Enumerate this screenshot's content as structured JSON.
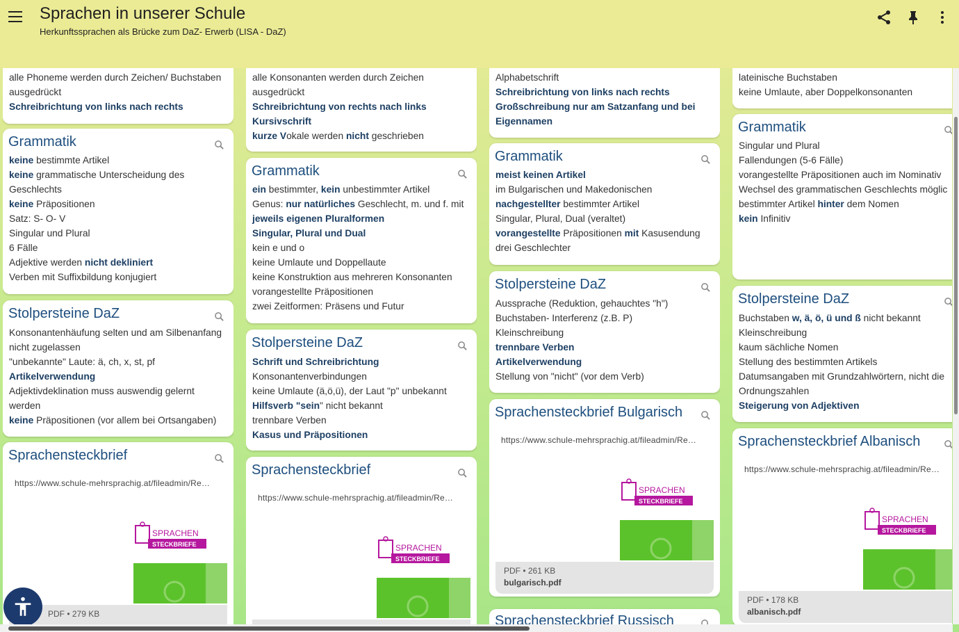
{
  "header": {
    "title": "Sprachen in unserer Schule",
    "subtitle": "Herkunftssprachen als Brücke zum DaZ- Erwerb (LISA - DaZ)",
    "icons": [
      "menu-icon",
      "share-icon",
      "pin-icon",
      "more-vert-icon"
    ]
  },
  "col1": {
    "top": [
      "alle Phoneme werden durch Zeichen/ Buchstaben",
      "ausgedrückt",
      "**Schreibrichtung von links nach rechts**"
    ],
    "gram_title": "Grammatik",
    "gram": [
      "**keine**  bestimmte Artikel",
      "**keine** grammatische Unterscheidung des",
      "Geschlechts",
      "**keine** Präpositionen",
      "Satz: S- O- V",
      "Singular und Plural",
      "6 Fälle",
      "Adjektive werden **nicht dekliniert**",
      "Verben mit Suffixbildung konjugiert"
    ],
    "stol_title": "Stolpersteine DaZ",
    "stol": [
      "Konsonantenhäufung selten und am Silbenanfang",
      "nicht zugelassen",
      "\"unbekannte\" Laute: ä, ch, x, st, pf",
      "**Artikelverwendung**",
      "Adjektivdeklination muss auswendig gelernt",
      "werden",
      "**keine** Präpositionen (vor allem bei Ortsangaben)"
    ],
    "brief_title": "Sprachensteckbrief",
    "brief_link": "https://www.schule-mehrsprachig.at/fileadmin/Re…",
    "brief_size": "PDF • 279 KB"
  },
  "col2": {
    "top": [
      "alle Konsonanten werden durch Zeichen",
      "ausgedrückt",
      "**Schreibrichtung von rechts nach links**",
      "**Kursivschrift**",
      "**kurze V**okale werden **nicht** geschrieben"
    ],
    "gram_title": "Grammatik",
    "gram": [
      "**ein** bestimmter, **kein** unbestimmter Artikel",
      "Genus: **nur natürliches** Geschlecht, m. und f. mit",
      "**jeweils eigenen Pluralformen**",
      "**Singular, Plural und Dual**",
      "kein e und o",
      "keine Umlaute und Doppellaute",
      "keine Konstruktion aus mehreren Konsonanten",
      "vorangestellte Präpositionen",
      "zwei Zeitformen: Präsens und Futur"
    ],
    "stol_title": "Stolpersteine DaZ",
    "stol": [
      "**Schrift und Schreibrichtung**",
      "Konsonantenverbindungen",
      "keine Umlaute (ä,ö,ü), der Laut \"p\" unbekannt",
      "**Hilfsverb \"sein**\" nicht bekannt",
      "trennbare Verben",
      "**Kasus und Präpositionen**"
    ],
    "brief_title": "Sprachensteckbrief",
    "brief_link": "https://www.schule-mehrsprachig.at/fileadmin/Re…"
  },
  "col3": {
    "top": [
      "Alphabetschrift",
      "**Schreibrichtung von links nach rechts**",
      "**Großschreibung nur am Satzanfang und bei**",
      "**Eigennamen**"
    ],
    "gram_title": "Grammatik",
    "gram": [
      "**meist keinen Artikel**",
      "im Bulgarischen und Makedonischen",
      "**nachgestellter** bestimmter Artikel",
      "Singular, Plural, Dual (veraltet)",
      "**vorangestellte** Präpositionen **mit** Kasusendung",
      "drei Geschlechter"
    ],
    "stol_title": "Stolpersteine DaZ",
    "stol": [
      "Aussprache (Reduktion, gehauchtes \"h\")",
      "Buchstaben- Interferenz (z.B. P)",
      "Kleinschreibung",
      "**trennbare Verben**",
      "**Artikelverwendung**",
      "Stellung von \"nicht\" (vor dem Verb)"
    ],
    "brief_title": "Sprachensteckbrief Bulgarisch",
    "brief_link": "https://www.schule-mehrsprachig.at/fileadmin/Re…",
    "brief_size": "PDF • 261 KB",
    "brief_file": "bulgarisch.pdf",
    "next_title": "Sprachensteckbrief Russisch"
  },
  "col4": {
    "top": [
      "lateinische Buchstaben",
      "keine Umlaute, aber Doppelkonsonanten"
    ],
    "gram_title": "Grammatik",
    "gram": [
      "Singular und Plural",
      "Fallendungen (5-6 Fälle)",
      "vorangestellte Präpositionen auch im Nominativ",
      "Wechsel des grammatischen Geschlechts möglic",
      "bestimmter Artikel **hinter** dem Nomen",
      "**kein** Infinitiv"
    ],
    "stol_title": "Stolpersteine DaZ",
    "stol": [
      "Buchstaben **w, ä, ö, ü und ß** nicht bekannt",
      "Kleinschreibung",
      "kaum sächliche Nomen",
      "Stellung des bestimmten Artikels",
      "Datumsangaben mit Grundzahlwörtern, nicht die",
      "Ordnungszahlen",
      "**Steigerung von Adjektiven**"
    ],
    "brief_title": "Sprachensteckbrief Albanisch",
    "brief_link": "https://www.schule-mehrsprachig.at/fileadmin/Re…",
    "brief_size": "PDF • 178 KB",
    "brief_file": "albanisch.pdf"
  },
  "logo": {
    "line1": "SPRACHEN",
    "line2": "STECKBRIEFE"
  },
  "colors": {
    "title_blue": "#1d4e7e",
    "header_bg": "#ebeb96",
    "accent_magenta": "#b5179e",
    "thumb_green": "#5cc22c"
  }
}
